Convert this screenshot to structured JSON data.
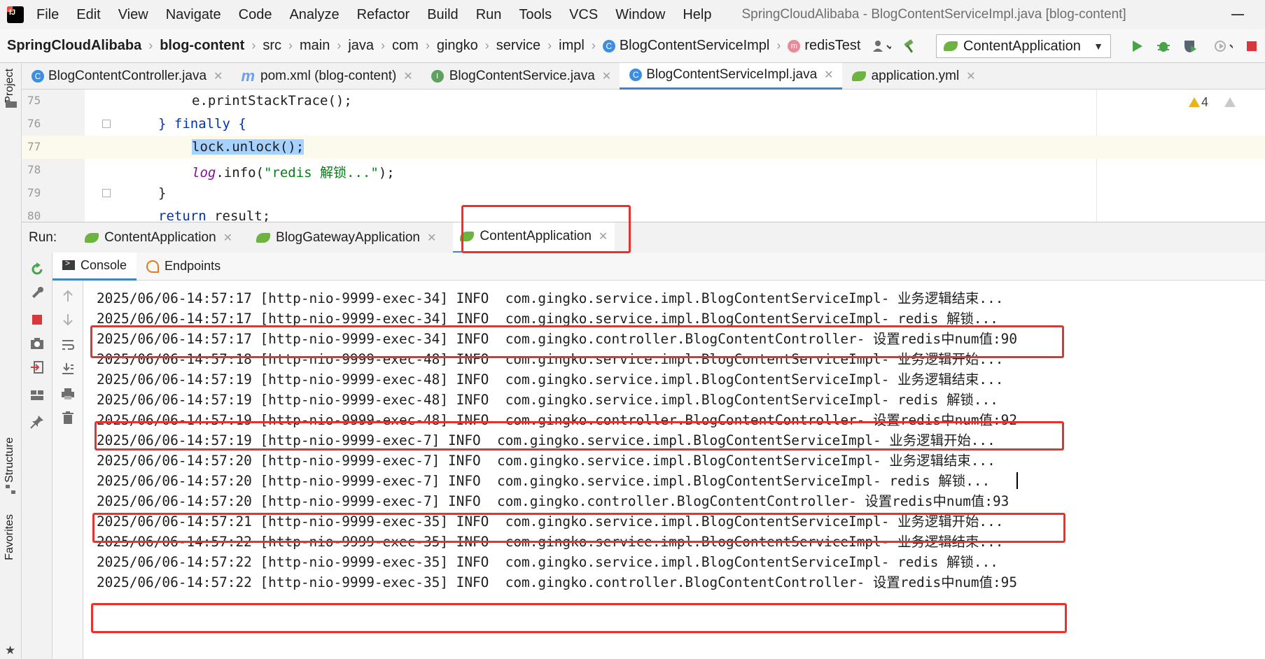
{
  "menubar": {
    "items": [
      "File",
      "Edit",
      "View",
      "Navigate",
      "Code",
      "Analyze",
      "Refactor",
      "Build",
      "Run",
      "Tools",
      "VCS",
      "Window",
      "Help"
    ],
    "window_title": "SpringCloudAlibaba - BlogContentServiceImpl.java [blog-content]"
  },
  "navbar": {
    "crumbs": [
      "SpringCloudAlibaba",
      "blog-content",
      "src",
      "main",
      "java",
      "com",
      "gingko",
      "service",
      "impl",
      "BlogContentServiceImpl",
      "redisTest"
    ],
    "run_config": "ContentApplication"
  },
  "leftstrip": {
    "project_label": "Project",
    "structure_label": "Structure",
    "favorites_label": "Favorites"
  },
  "editor_tabs": [
    {
      "label": "BlogContentController.java",
      "icon": "class-icon"
    },
    {
      "label": "pom.xml (blog-content)",
      "icon": "maven-icon"
    },
    {
      "label": "BlogContentService.java",
      "icon": "interface-icon"
    },
    {
      "label": "BlogContentServiceImpl.java",
      "icon": "class-icon",
      "active": true
    },
    {
      "label": "application.yml",
      "icon": "spring-leaf-icon"
    }
  ],
  "editor": {
    "lines": [
      {
        "num": "75",
        "text": "e.printStackTrace();"
      },
      {
        "num": "76",
        "kw": "} finally {"
      },
      {
        "num": "77",
        "text": "lock.unlock();"
      },
      {
        "num": "78",
        "field": "log",
        "call": ".info(",
        "str": "\"redis 解锁...\"",
        "end": ");"
      },
      {
        "num": "79",
        "text": "}"
      },
      {
        "num": "80",
        "kw": "return",
        "text": " result;"
      }
    ],
    "warning_count": "4"
  },
  "run": {
    "label": "Run:",
    "tabs": [
      {
        "label": "ContentApplication"
      },
      {
        "label": "BlogGatewayApplication"
      },
      {
        "label": "ContentApplication",
        "active": true
      }
    ],
    "subtabs": [
      "Console",
      "Endpoints"
    ]
  },
  "console": {
    "lines": [
      "2025/06/06-14:57:17 [http-nio-9999-exec-34] INFO  com.gingko.service.impl.BlogContentServiceImpl- 业务逻辑结束...",
      "2025/06/06-14:57:17 [http-nio-9999-exec-34] INFO  com.gingko.service.impl.BlogContentServiceImpl- redis 解锁...",
      "2025/06/06-14:57:17 [http-nio-9999-exec-34] INFO  com.gingko.controller.BlogContentController- 设置redis中num值:90",
      "2025/06/06-14:57:18 [http-nio-9999-exec-48] INFO  com.gingko.service.impl.BlogContentServiceImpl- 业务逻辑开始...",
      "2025/06/06-14:57:19 [http-nio-9999-exec-48] INFO  com.gingko.service.impl.BlogContentServiceImpl- 业务逻辑结束...",
      "2025/06/06-14:57:19 [http-nio-9999-exec-48] INFO  com.gingko.service.impl.BlogContentServiceImpl- redis 解锁...",
      "2025/06/06-14:57:19 [http-nio-9999-exec-48] INFO  com.gingko.controller.BlogContentController- 设置redis中num值:92",
      "2025/06/06-14:57:19 [http-nio-9999-exec-7] INFO  com.gingko.service.impl.BlogContentServiceImpl- 业务逻辑开始...",
      "2025/06/06-14:57:20 [http-nio-9999-exec-7] INFO  com.gingko.service.impl.BlogContentServiceImpl- 业务逻辑结束...",
      "2025/06/06-14:57:20 [http-nio-9999-exec-7] INFO  com.gingko.service.impl.BlogContentServiceImpl- redis 解锁...",
      "2025/06/06-14:57:20 [http-nio-9999-exec-7] INFO  com.gingko.controller.BlogContentController- 设置redis中num值:93",
      "2025/06/06-14:57:21 [http-nio-9999-exec-35] INFO  com.gingko.service.impl.BlogContentServiceImpl- 业务逻辑开始...",
      "2025/06/06-14:57:22 [http-nio-9999-exec-35] INFO  com.gingko.service.impl.BlogContentServiceImpl- 业务逻辑结束...",
      "2025/06/06-14:57:22 [http-nio-9999-exec-35] INFO  com.gingko.service.impl.BlogContentServiceImpl- redis 解锁...",
      "2025/06/06-14:57:22 [http-nio-9999-exec-35] INFO  com.gingko.controller.BlogContentController- 设置redis中num值:95"
    ]
  },
  "colors": {
    "highlight_box": "#e8322e",
    "accent_tab": "#4083c9",
    "keyword": "#0033b3",
    "string": "#067d17"
  }
}
